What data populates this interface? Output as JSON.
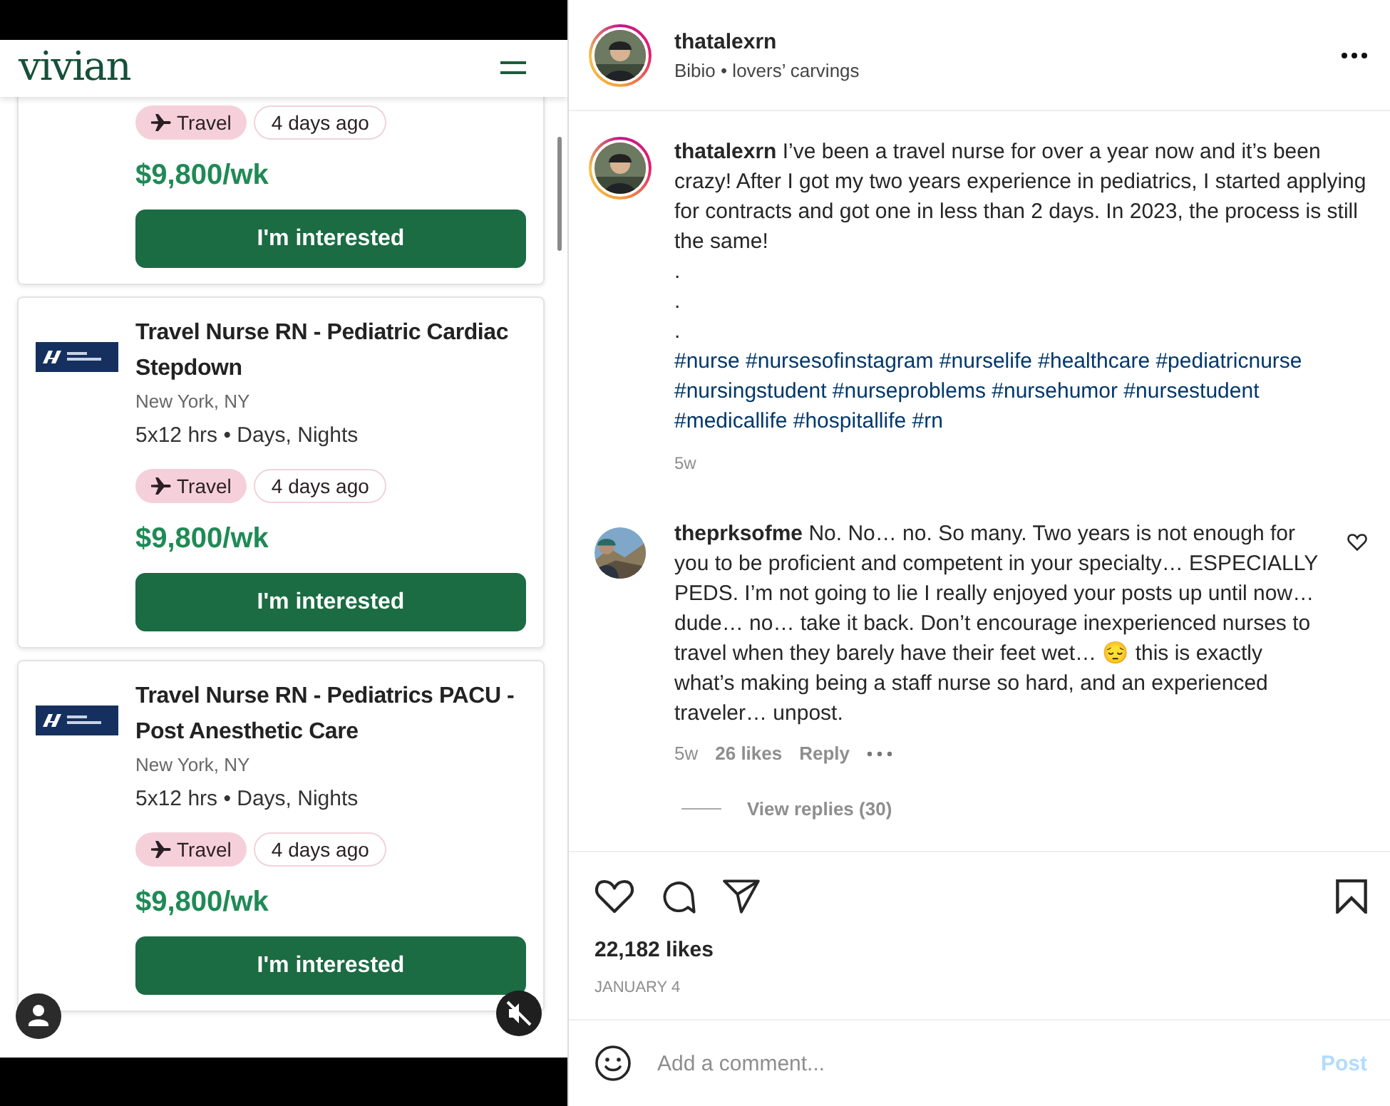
{
  "video": {
    "logo": "vivian",
    "jobs": [
      {
        "tags": [
          {
            "kind": "travel",
            "label": "Travel"
          },
          {
            "kind": "age",
            "label": "4 days ago"
          }
        ],
        "pay": "$9,800/wk",
        "button": "I'm interested"
      },
      {
        "title": "Travel Nurse RN - Pediatric Cardiac Stepdown",
        "location": "New York, NY",
        "schedule": "5x12 hrs • Days, Nights",
        "tags": [
          {
            "kind": "travel",
            "label": "Travel"
          },
          {
            "kind": "age",
            "label": "4 days ago"
          }
        ],
        "pay": "$9,800/wk",
        "button": "I'm interested"
      },
      {
        "title": "Travel Nurse RN - Pediatrics PACU - Post Anesthetic Care",
        "location": "New York, NY",
        "schedule": "5x12 hrs • Days, Nights",
        "tags": [
          {
            "kind": "travel",
            "label": "Travel"
          },
          {
            "kind": "age",
            "label": "4 days ago"
          }
        ],
        "pay": "$9,800/wk",
        "button": "I'm interested"
      }
    ],
    "muted": true
  },
  "post": {
    "author": {
      "username": "thatalexrn",
      "subtitle": "Bibio • lovers’ carvings"
    },
    "caption": {
      "text": "**thatalexrn** I’ve been a travel nurse for over a year now and it’s been crazy! After I got my two years experience in pediatrics, I started applying for contracts and got one in less than 2 days. In 2023, the process is still the same!",
      "dots": [
        ".",
        ".",
        "."
      ],
      "hashtags": "#nurse #nursesofinstagram #nurselife #healthcare #pediatricnurse #nursingstudent #nurseproblems #nursehumor #nursestudent #medicallife #hospitallife #rn",
      "time": "5w"
    },
    "comments": [
      {
        "text": "**theprksofme** No. No… no. So many. Two years is not enough for you to be proficient and competent in your specialty… ESPECIALLY PEDS. I’m not going to lie I really enjoyed your posts up until now… dude… no… take it back. Don’t encourage inexperienced nurses to travel when they barely have their feet wet… 😔 this is exactly what’s making being a staff nurse so hard, and an experienced traveler… unpost.",
        "time": "5w",
        "likes": "26 likes",
        "reply": "Reply",
        "view_replies": "View replies (30)",
        "liked": false
      }
    ],
    "liked": false,
    "saved": false,
    "likes": "22,182 likes",
    "date": "JANUARY 4",
    "comment_field": {
      "placeholder": "Add a comment..."
    },
    "post_button": {
      "label": "Post",
      "disabled": true
    }
  }
}
